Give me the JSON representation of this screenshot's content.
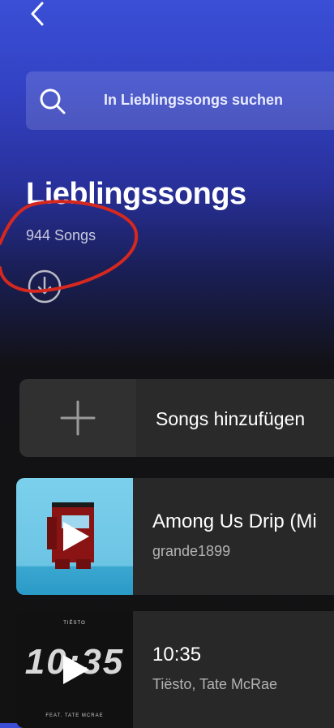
{
  "header": {
    "back_icon": "chevron-left-icon",
    "search_placeholder": "In Lieblingssongs suchen"
  },
  "playlist": {
    "title": "Lieblingssongs",
    "song_count": "944 Songs",
    "download_icon": "download-circle-icon"
  },
  "add_songs": {
    "label": "Songs hinzufügen",
    "icon": "plus-icon"
  },
  "tracks": [
    {
      "title": "Among Us Drip (Mi",
      "artist": "grande1899",
      "icon": "play-icon"
    },
    {
      "title": "10:35",
      "artist": "Tiësto, Tate McRae",
      "icon": "play-icon",
      "art_text_top": "TIËSTO",
      "art_text_big": "10:35",
      "art_text_bottom": "FEAT. TATE MCRAE"
    }
  ],
  "colors": {
    "header_top": "#3a4fd6",
    "background": "#121212",
    "annotation": "#d7281f"
  }
}
